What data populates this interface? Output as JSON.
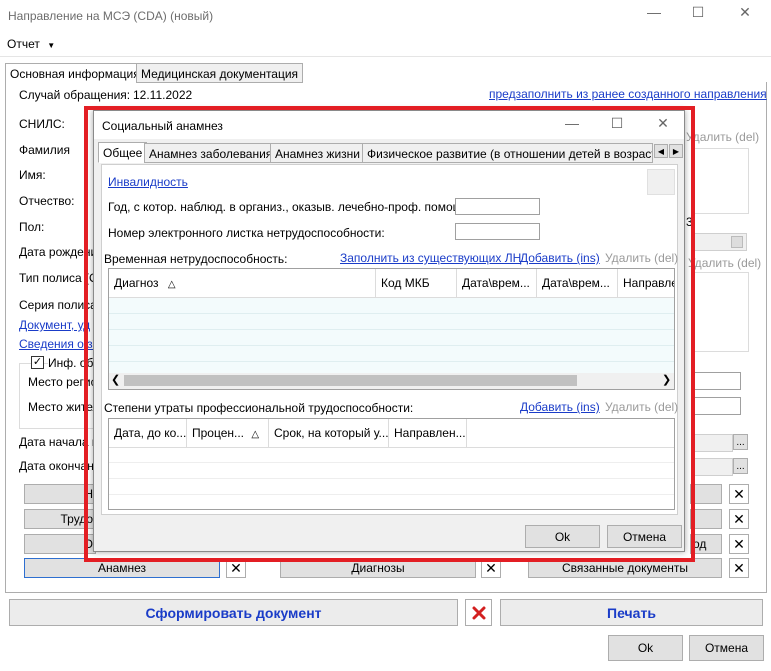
{
  "window": {
    "title": "Направление на МСЭ (CDA) (новый)",
    "menu_report": "Отчет",
    "tabs": [
      "Основная информация",
      "Медицинская документация"
    ]
  },
  "form": {
    "case_label": "Случай обращения:",
    "case_date": "12.11.2022",
    "prefill_link": "предзаполнить из ранее созданного направления",
    "snils": "СНИЛС:",
    "surname": "Фамилия",
    "name": "Имя:",
    "patronymic": "Отчество:",
    "sex": "Пол:",
    "birth_date": "Дата рождения",
    "policy_type": "Тип полиса (ОМ",
    "policy_series": "Серия полиса:",
    "document_link": "Документ, уд",
    "info_link": "Сведения о за",
    "inf_checkbox": "Инф. об",
    "reg_place": "Место регист",
    "live_place": "Место житель",
    "start_date": "Дата начала к",
    "end_date": "Дата окончани",
    "remove_right1": "Удалить (del)",
    "remove_right2": "Удалить (del)",
    "code_partial": "3",
    "btn_partial_1": "Н",
    "btn_partial_2": "Трудо",
    "btn_partial_3": "О",
    "btn_partial_4": "од",
    "btn_anamnesis": "Анамнез",
    "btn_diagnoses": "Диагнозы",
    "btn_related": "Связанные документы",
    "btn_form_doc": "Сформировать документ",
    "btn_print": "Печать",
    "btn_ok": "Ok",
    "btn_cancel": "Отмена",
    "ellipsis": "..."
  },
  "dialog": {
    "title": "Социальный анамнез",
    "tabs": [
      "Общее",
      "Анамнез заболевания",
      "Анамнез жизни",
      "Физическое развитие (в отношении детей в возрасте д"
    ],
    "disability_link": "Инвалидность",
    "year_label": "Год, с котор. наблюд. в организ., оказыв. лечебно-проф. помощь:",
    "eln_label": "Номер электронного листка нетрудоспособности:",
    "temp_label": "Временная нетрудоспособность:",
    "fill_from_ln": "Заполнить из существующих ЛН",
    "add_ins": "Добавить (ins)",
    "remove_del": "Удалить (del)",
    "grid1_cols": [
      "Диагноз",
      "Код МКБ",
      "Дата\\врем...",
      "Дата\\врем...",
      "Направлен"
    ],
    "loss_label": "Степени утраты профессиональной трудоспособности:",
    "add_ins2": "Добавить (ins)",
    "remove_del2": "Удалить (del)",
    "grid2_cols": [
      "Дата, до ко...",
      "Процен...",
      "Срок, на который у...",
      "Направлен..."
    ],
    "ok": "Ok",
    "cancel": "Отмена"
  },
  "icons": {
    "minimize": "minimize-icon",
    "maximize": "maximize-icon",
    "close": "close-icon",
    "delete": "delete-x-icon"
  },
  "colors": {
    "highlight_red": "#e31e24",
    "link_blue": "#1a3cc8",
    "primary_text": "#1a3cc8"
  }
}
